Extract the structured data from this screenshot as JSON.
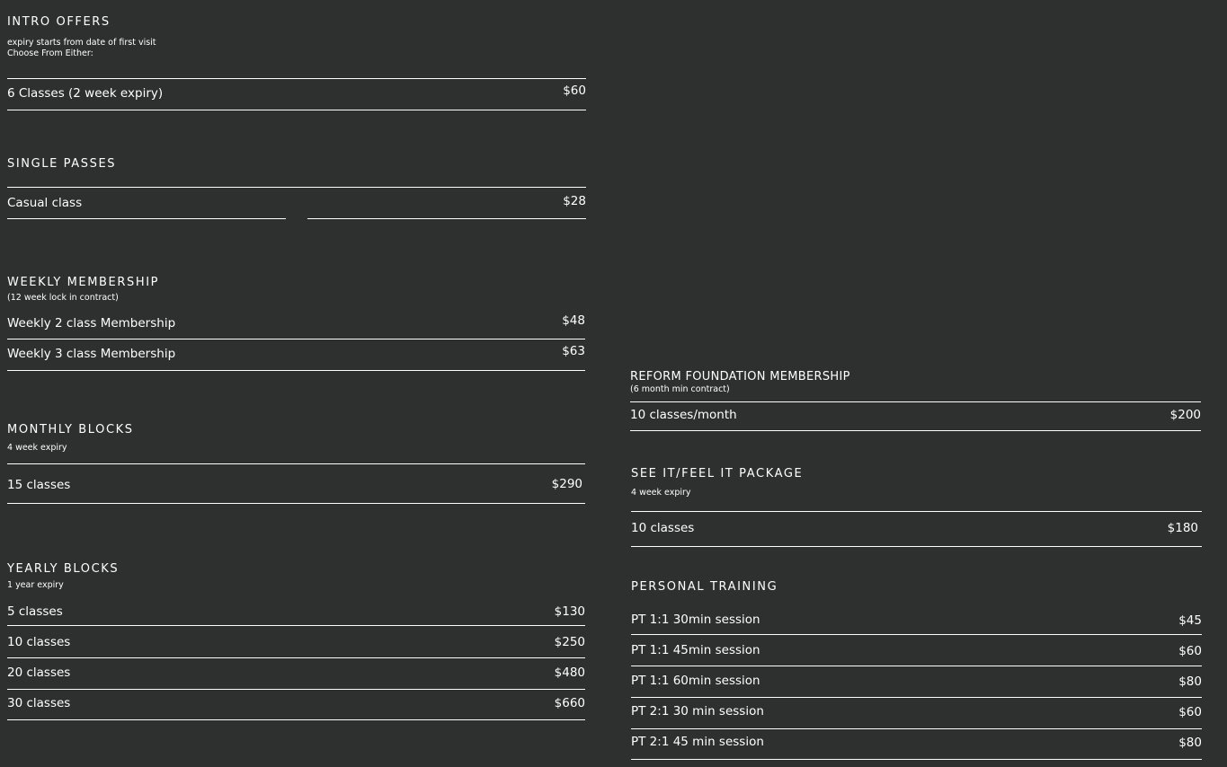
{
  "colors": {
    "background": "#2e2f2f",
    "text": "#ffffff"
  },
  "intro": {
    "title": "INTRO OFFERS",
    "sub1": "expiry starts from date of first visit",
    "sub2": "Choose From Either:",
    "items": [
      {
        "name": "6 Classes (2 week expiry)",
        "price": "$60"
      }
    ]
  },
  "single": {
    "title": "SINGLE PASSES",
    "items": [
      {
        "name": "Casual class",
        "price": "$28"
      }
    ]
  },
  "weekly": {
    "title": "WEEKLY MEMBERSHIP",
    "sub": "(12 week lock in contract)",
    "items": [
      {
        "name": "Weekly 2 class Membership",
        "price": "$48"
      },
      {
        "name": "Weekly 3 class Membership",
        "price": "$63"
      }
    ]
  },
  "monthly": {
    "title": "MONTHLY BLOCKS",
    "sub": "4 week  expiry",
    "items": [
      {
        "name": "15 classes",
        "price": "$290"
      }
    ]
  },
  "yearly": {
    "title": "YEARLY BLOCKS",
    "sub": "1 year expiry",
    "items": [
      {
        "name": "5 classes",
        "price": "$130"
      },
      {
        "name": "10 classes",
        "price": "$250"
      },
      {
        "name": "20 classes",
        "price": "$480"
      },
      {
        "name": "30 classes",
        "price": "$660"
      }
    ]
  },
  "reform": {
    "title": "REFORM FOUNDATION MEMBERSHIP",
    "sub": "(6 month min contract)",
    "items": [
      {
        "name": "10 classes/month",
        "price": "$200"
      }
    ]
  },
  "seeit": {
    "title": "SEE IT/FEEL IT PACKAGE",
    "sub": "4 week expiry",
    "items": [
      {
        "name": "10 classes",
        "price": "$180"
      }
    ]
  },
  "pt": {
    "title": "PERSONAL TRAINING",
    "items": [
      {
        "name": "PT 1:1 30min session",
        "price": "$45"
      },
      {
        "name": "PT 1:1 45min session",
        "price": "$60"
      },
      {
        "name": "PT 1:1 60min session",
        "price": "$80"
      },
      {
        "name": "PT 2:1 30 min session",
        "price": "$60"
      },
      {
        "name": "PT 2:1 45 min session",
        "price": "$80"
      }
    ]
  }
}
